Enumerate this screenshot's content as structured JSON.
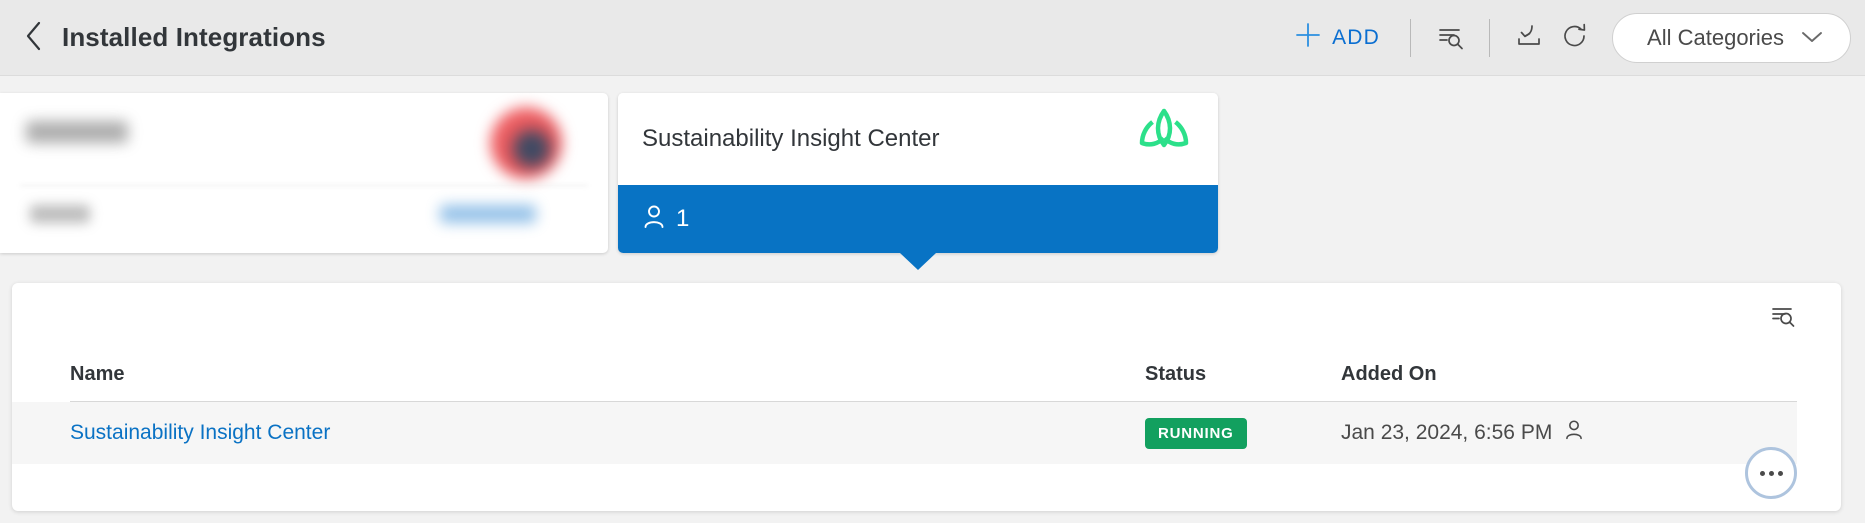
{
  "header": {
    "back_icon": "chevron-left-icon",
    "title": "Installed Integrations",
    "add_label": "ADD",
    "add_icon": "plus-icon",
    "filter_icon": "filter-search-icon",
    "import_icon": "download-tray-icon",
    "refresh_icon": "refresh-icon",
    "categories_label": "All Categories",
    "categories_chevron": "chevron-down-icon",
    "accent_color": "#0a6ed1",
    "background_color": "#e9e9e9"
  },
  "cards": [
    {
      "name": "",
      "redacted": true,
      "logo_icon": "redacted-circular-logo",
      "link_label": ""
    },
    {
      "name": "Sustainability Insight Center",
      "redacted": false,
      "logo_icon": "lotus-leaf-icon",
      "logo_color": "#2ce08a",
      "count_icon": "person-icon",
      "count": "1",
      "footer_color": "#0873c4",
      "selected": true
    }
  ],
  "panel": {
    "toolbar": {
      "filter_icon": "filter-search-icon"
    },
    "table": {
      "columns": [
        "Name",
        "Status",
        "Added On",
        ""
      ],
      "rows": [
        {
          "name": "Sustainability Insight Center",
          "status": "RUNNING",
          "status_color": "#12a05f",
          "added_on": "Jan 23, 2024, 6:56 PM",
          "added_by_icon": "person-icon",
          "overflow_icon": "ellipsis-icon"
        }
      ]
    }
  }
}
